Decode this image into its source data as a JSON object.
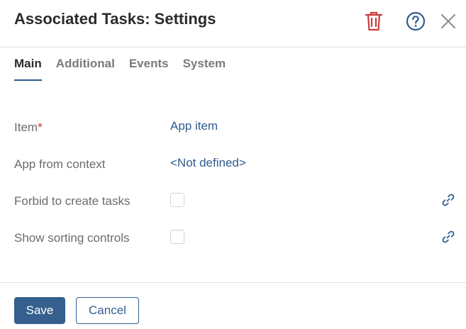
{
  "header": {
    "title": "Associated Tasks: Settings",
    "icons": [
      "trash-icon",
      "help-icon",
      "close-icon"
    ]
  },
  "tabs": [
    {
      "label": "Main",
      "active": true
    },
    {
      "label": "Additional",
      "active": false
    },
    {
      "label": "Events",
      "active": false
    },
    {
      "label": "System",
      "active": false
    }
  ],
  "fields": {
    "item": {
      "label": "Item",
      "required_mark": "*",
      "value": "App item"
    },
    "app_from_context": {
      "label": "App from context",
      "value": "<Not defined>"
    },
    "forbid_create_tasks": {
      "label": "Forbid to create tasks",
      "checked": false
    },
    "show_sorting_controls": {
      "label": "Show sorting controls",
      "checked": false
    }
  },
  "footer": {
    "save_label": "Save",
    "cancel_label": "Cancel"
  },
  "colors": {
    "accent": "#35608e",
    "link": "#2e5d8e",
    "delete": "#cc3b3b",
    "required": "#cc2e2e"
  }
}
